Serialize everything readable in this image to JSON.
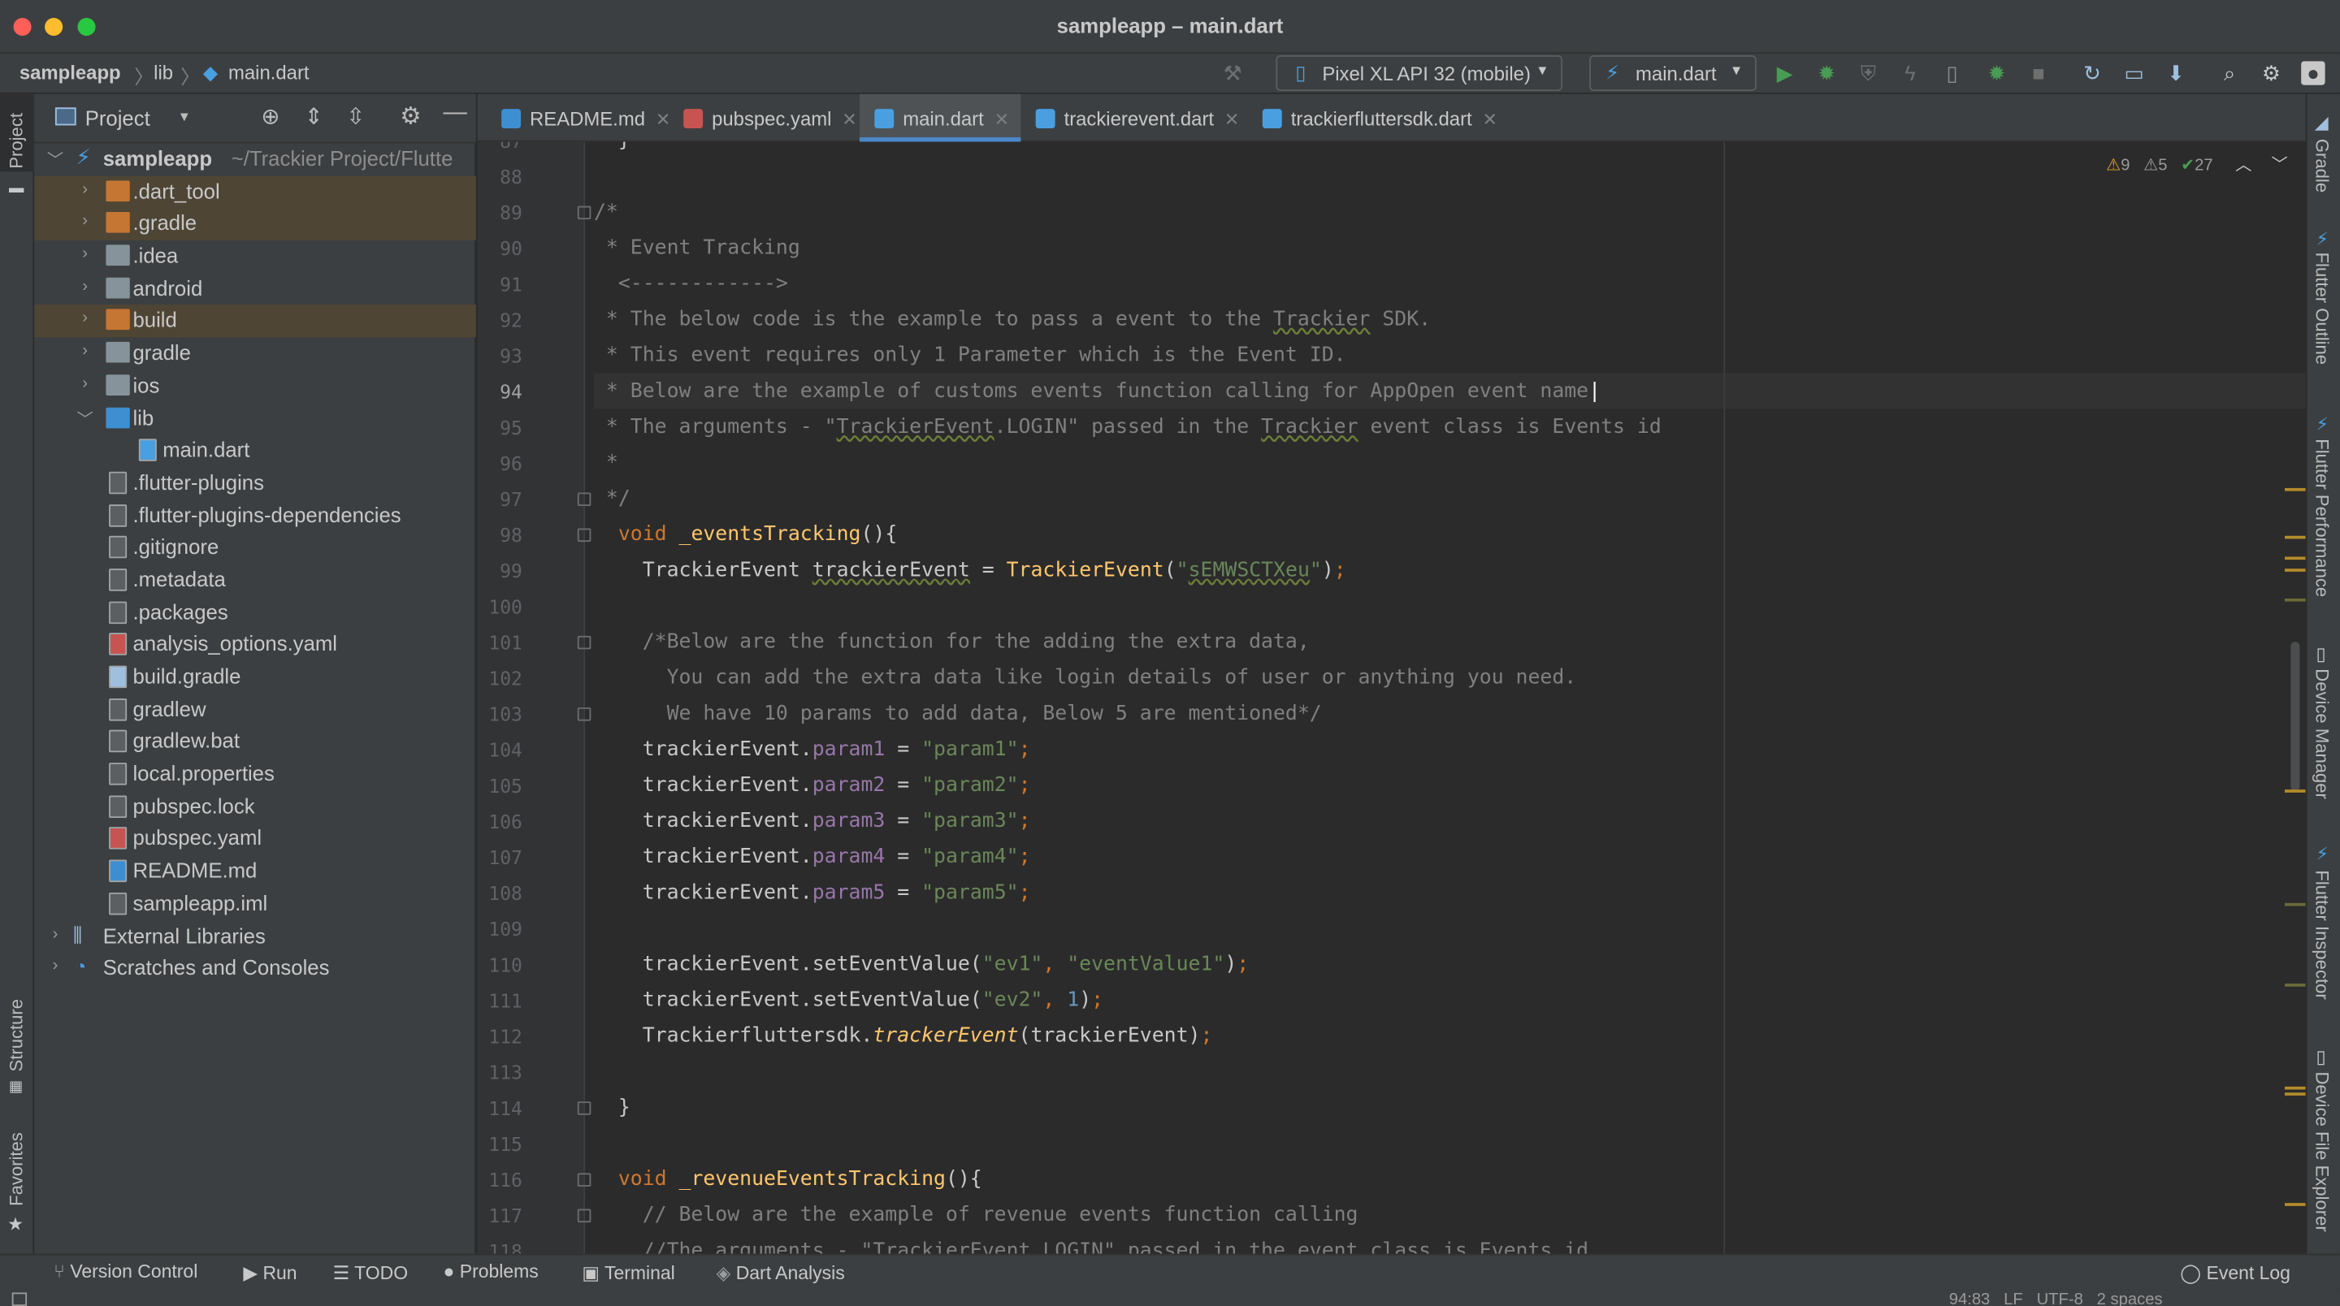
{
  "window": {
    "title": "sampleapp – main.dart"
  },
  "breadcrumb": [
    "sampleapp",
    "lib",
    "main.dart"
  ],
  "toolbar": {
    "device": "Pixel XL API 32 (mobile)",
    "config": "main.dart"
  },
  "project_panel": {
    "title": "Project",
    "root": {
      "name": "sampleapp",
      "path": "~/Trackier Project/Flutte"
    },
    "items": [
      {
        "label": ".dart_tool",
        "kind": "folder-excluded"
      },
      {
        "label": ".gradle",
        "kind": "folder-excluded"
      },
      {
        "label": ".idea",
        "kind": "folder"
      },
      {
        "label": "android",
        "kind": "folder"
      },
      {
        "label": "build",
        "kind": "folder-excluded"
      },
      {
        "label": "gradle",
        "kind": "folder"
      },
      {
        "label": "ios",
        "kind": "folder"
      },
      {
        "label": "lib",
        "kind": "folder-open"
      },
      {
        "label": "main.dart",
        "kind": "dart-file"
      },
      {
        "label": ".flutter-plugins",
        "kind": "file"
      },
      {
        "label": ".flutter-plugins-dependencies",
        "kind": "file"
      },
      {
        "label": ".gitignore",
        "kind": "file"
      },
      {
        "label": ".metadata",
        "kind": "file"
      },
      {
        "label": ".packages",
        "kind": "file"
      },
      {
        "label": "analysis_options.yaml",
        "kind": "yaml-file"
      },
      {
        "label": "build.gradle",
        "kind": "gradle-file"
      },
      {
        "label": "gradlew",
        "kind": "file"
      },
      {
        "label": "gradlew.bat",
        "kind": "file"
      },
      {
        "label": "local.properties",
        "kind": "file"
      },
      {
        "label": "pubspec.lock",
        "kind": "file"
      },
      {
        "label": "pubspec.yaml",
        "kind": "yaml-file"
      },
      {
        "label": "README.md",
        "kind": "md-file"
      },
      {
        "label": "sampleapp.iml",
        "kind": "file"
      }
    ],
    "external_libraries": "External Libraries",
    "scratches": "Scratches and Consoles"
  },
  "tabs": [
    {
      "label": "README.md",
      "active": false
    },
    {
      "label": "pubspec.yaml",
      "active": false
    },
    {
      "label": "main.dart",
      "active": true
    },
    {
      "label": "trackierevent.dart",
      "active": false
    },
    {
      "label": "trackierfluttersdk.dart",
      "active": false
    }
  ],
  "inspections": {
    "errors": "9",
    "warnings": "5",
    "ok": "27"
  },
  "editor": {
    "current_line": 94,
    "line_numbers": [
      "87",
      "88",
      "89",
      "90",
      "91",
      "92",
      "93",
      "94",
      "95",
      "96",
      "97",
      "98",
      "99",
      "100",
      "101",
      "102",
      "103",
      "104",
      "105",
      "106",
      "107",
      "108",
      "109",
      "110",
      "111",
      "112",
      "113",
      "114",
      "115",
      "116",
      "117",
      "118"
    ]
  },
  "left_tools": {
    "project": "Project",
    "structure": "Structure",
    "favorites": "Favorites"
  },
  "right_tools": [
    "Gradle",
    "Flutter Outline",
    "Flutter Performance",
    "Device Manager",
    "Flutter Inspector",
    "Device File Explorer"
  ],
  "status_tools": [
    "Version Control",
    "Run",
    "TODO",
    "Problems",
    "Terminal",
    "Dart Analysis"
  ],
  "event_log": "Event Log",
  "status_info": {
    "position": "94:83",
    "line_sep": "LF",
    "encoding": "UTF-8",
    "indent": "2 spaces"
  },
  "colors": {
    "accent": "#4a88c7",
    "keyword": "#cc7832",
    "function": "#ffc66d",
    "string": "#6a8759",
    "comment": "#808080"
  }
}
